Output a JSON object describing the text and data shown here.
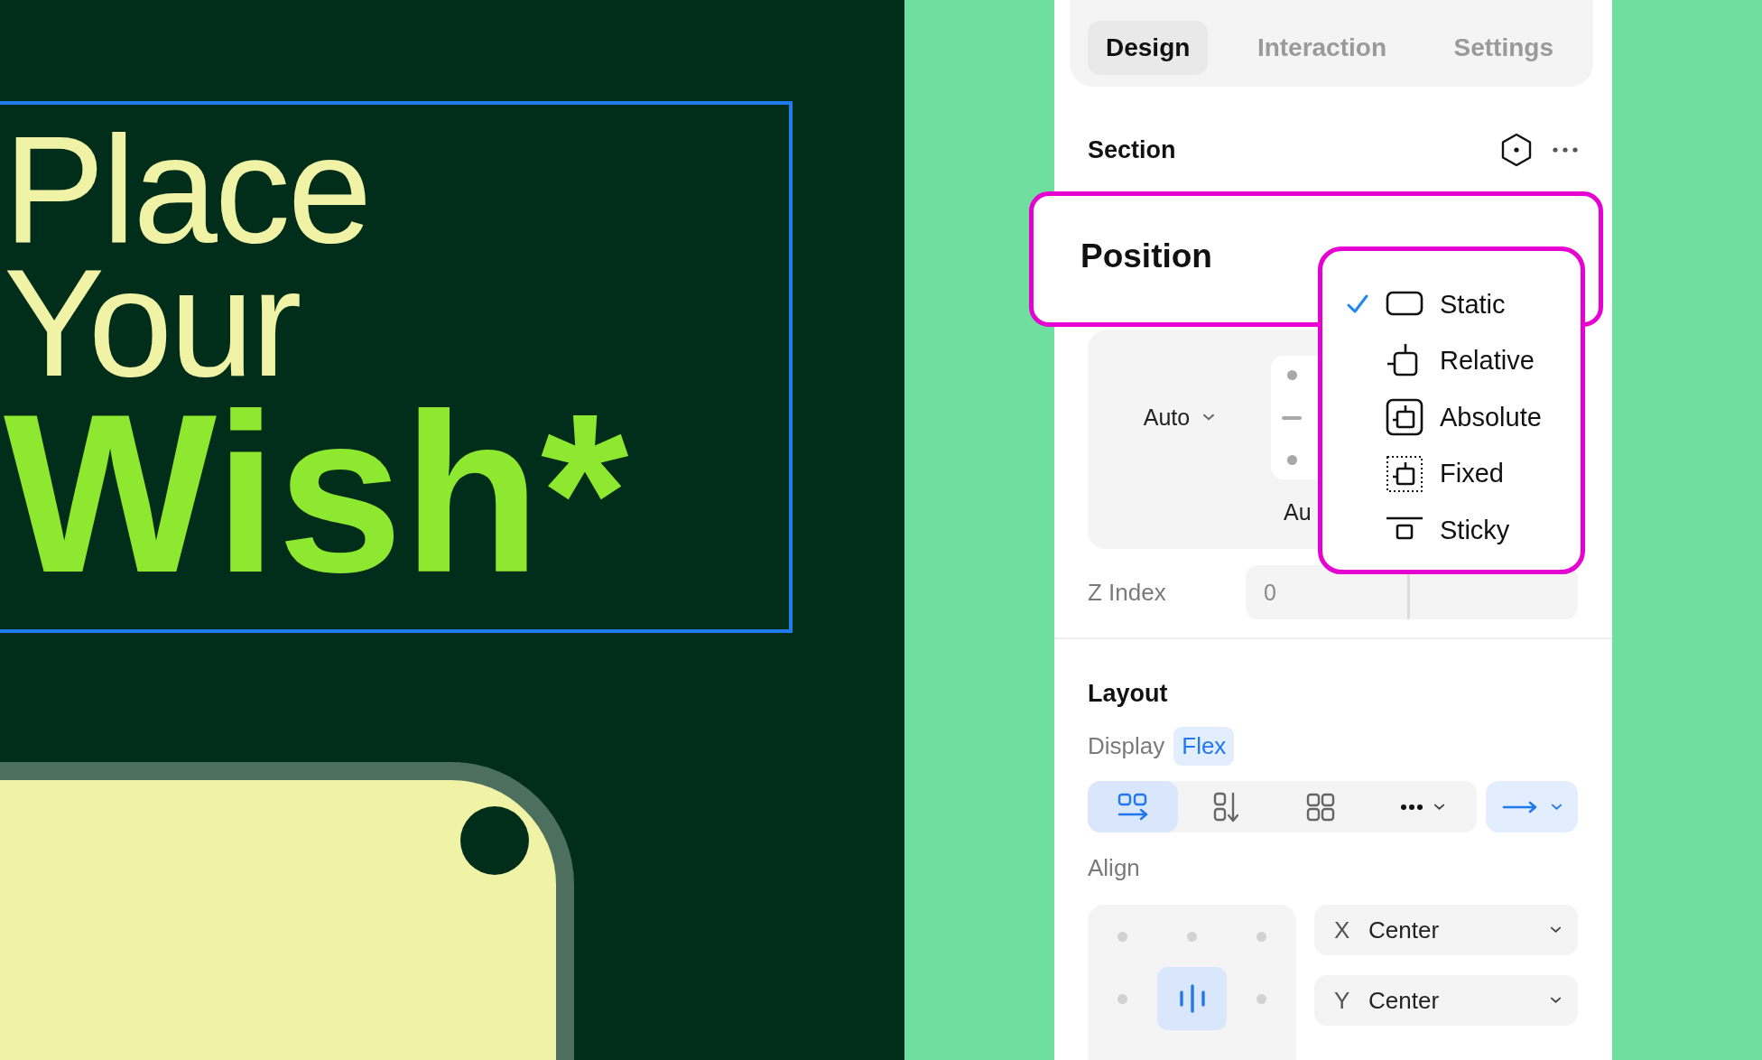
{
  "canvas": {
    "heading_lines": [
      {
        "text": "Place",
        "kind": "light"
      },
      {
        "text": "Your",
        "kind": "light"
      },
      {
        "text": "Wish*",
        "kind": "bold"
      }
    ]
  },
  "panel": {
    "tabs": [
      {
        "label": "Design",
        "selected": true
      },
      {
        "label": "Interaction",
        "selected": false
      },
      {
        "label": "Settings",
        "selected": false
      }
    ],
    "section": {
      "title": "Section"
    },
    "position": {
      "label": "Position",
      "options": [
        {
          "label": "Static",
          "kind": "static",
          "selected": true
        },
        {
          "label": "Relative",
          "kind": "relative",
          "selected": false
        },
        {
          "label": "Absolute",
          "kind": "absolute",
          "selected": false
        },
        {
          "label": "Fixed",
          "kind": "fixed",
          "selected": false
        },
        {
          "label": "Sticky",
          "kind": "sticky",
          "selected": false
        }
      ]
    },
    "placement": {
      "value": "Auto",
      "partial_label": "Au"
    },
    "z_index": {
      "label": "Z Index",
      "placeholder": "0"
    },
    "layout": {
      "title": "Layout",
      "display_label": "Display",
      "display_value": "Flex",
      "direction_buttons": [
        {
          "kind": "row",
          "selected": true
        },
        {
          "kind": "column",
          "selected": false
        },
        {
          "kind": "grid",
          "selected": false
        },
        {
          "kind": "more",
          "selected": false
        }
      ],
      "align_label": "Align",
      "align_cells": [
        {
          "selected": false
        },
        {
          "selected": false
        },
        {
          "selected": false
        },
        {
          "selected": false
        },
        {
          "selected": true
        },
        {
          "selected": false
        }
      ],
      "axes": [
        {
          "axis": "X",
          "value": "Center"
        },
        {
          "axis": "Y",
          "value": "Center"
        }
      ]
    }
  }
}
